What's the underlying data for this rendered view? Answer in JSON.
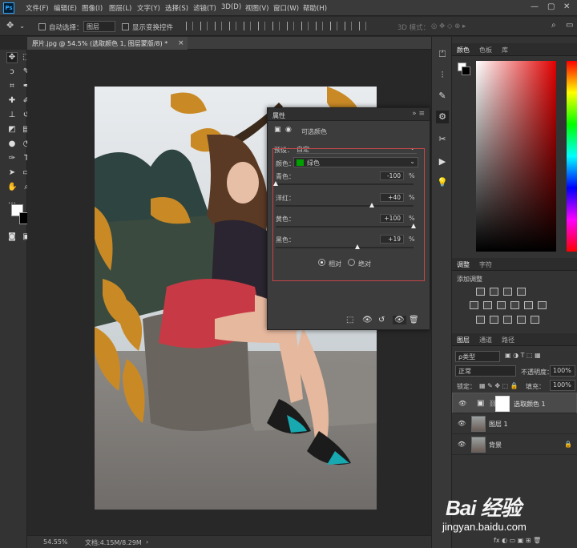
{
  "menubar": {
    "logo": "Ps",
    "items": [
      "文件(F)",
      "编辑(E)",
      "图像(I)",
      "图层(L)",
      "文字(Y)",
      "选择(S)",
      "滤镜(T)",
      "3D(D)",
      "视图(V)",
      "窗口(W)",
      "帮助(H)"
    ]
  },
  "options": {
    "auto_select_label": "自动选择：",
    "auto_select_value": "图层",
    "show_transform_label": "显示变换控件",
    "mode_3d_label": "3D 模式："
  },
  "document": {
    "tab_title": "原片.jpg @ 54.5% (选取颜色 1, 图层蒙版/8) *",
    "close_glyph": "×"
  },
  "status": {
    "zoom": "54.55%",
    "doc_info": "文档:4.15M/8.29M"
  },
  "properties": {
    "title": "属性",
    "adjustment_name": "可选颜色",
    "preset_label": "预设：",
    "preset_value": "自定",
    "colors_label": "颜色：",
    "colors_value": "绿色",
    "sliders": [
      {
        "label": "青色：",
        "value": "-100",
        "unit": "%",
        "level": -100
      },
      {
        "label": "洋红：",
        "value": "+40",
        "unit": "%",
        "level": 40
      },
      {
        "label": "黄色：",
        "value": "+100",
        "unit": "%",
        "level": 100
      },
      {
        "label": "黑色：",
        "value": "+19",
        "unit": "%",
        "level": 19
      }
    ],
    "relative_label": "相对",
    "absolute_label": "绝对"
  },
  "color_panel": {
    "tabs": [
      "颜色",
      "色板",
      "库"
    ]
  },
  "adjust_panel": {
    "tabs": [
      "调整",
      "字符"
    ],
    "add_label": "添加调整"
  },
  "layers_panel": {
    "tabs": [
      "图层",
      "通道",
      "路径"
    ],
    "kind_label": "ρ类型",
    "blend_mode": "正常",
    "opacity_label": "不透明度：",
    "opacity_value": "100%",
    "lock_label": "锁定：",
    "fill_label": "填充：",
    "fill_value": "100%",
    "layers": [
      {
        "name": "选取颜色 1"
      },
      {
        "name": "图层 1"
      },
      {
        "name": "背景"
      }
    ],
    "bottom_icons": "fx ◐ ▭ ▣ ⊞ 🗑"
  },
  "watermark": {
    "brand": "Bai 经验",
    "url": "jingyan.baidu.com"
  },
  "colors": {
    "accent": "#31a8ff",
    "highlight_box": "#c8464a",
    "green_swatch": "#00a000"
  }
}
